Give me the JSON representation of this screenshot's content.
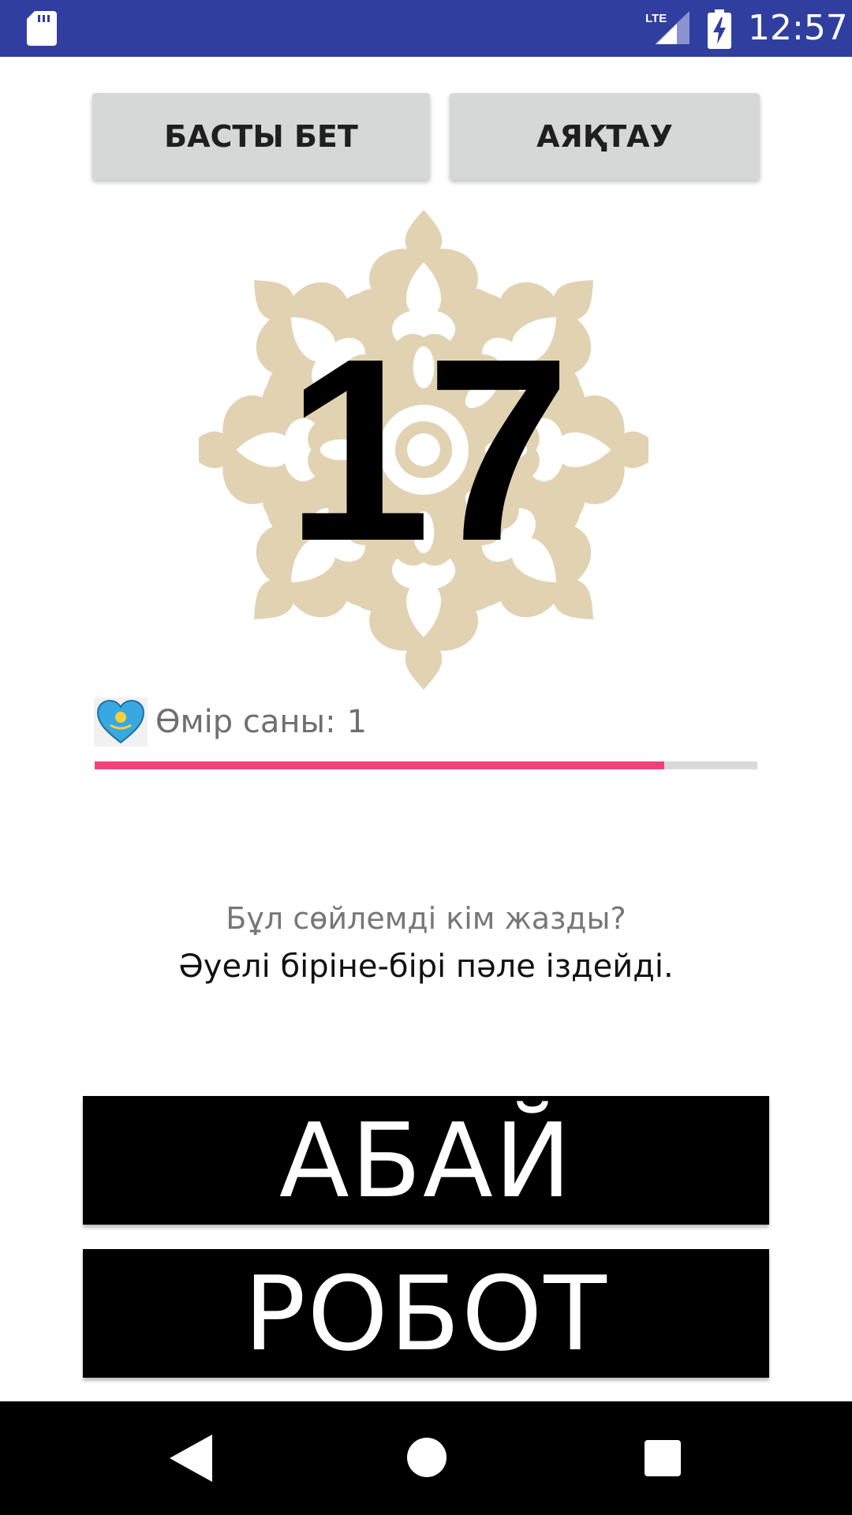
{
  "status_bar": {
    "time": "12:57",
    "network": "LTE",
    "icons": [
      "sd-card-icon",
      "lte-signal-icon",
      "battery-charging-icon"
    ],
    "color": "#303F9F"
  },
  "top_buttons": {
    "home_label": "БАСТЫ БЕТ",
    "finish_label": "АЯҚТАУ"
  },
  "counter": {
    "value": "17",
    "background_icon": "kazakh-ornament-icon"
  },
  "lives": {
    "icon": "kazakhstan-flag-heart-icon",
    "label": "Өмір саны:",
    "value": "1"
  },
  "progress": {
    "fraction": 0.86,
    "fill_color": "#F2407A",
    "track_color": "#D9D9D9"
  },
  "question": {
    "prompt": "Бұл сөйлемді кім жазды?",
    "quote": "Әуелі біріне-бірі пәле іздейді."
  },
  "answers": [
    "АБАЙ",
    "РОБОТ"
  ],
  "nav_bar": {
    "icons": [
      "back-icon",
      "home-icon",
      "recents-icon"
    ]
  }
}
